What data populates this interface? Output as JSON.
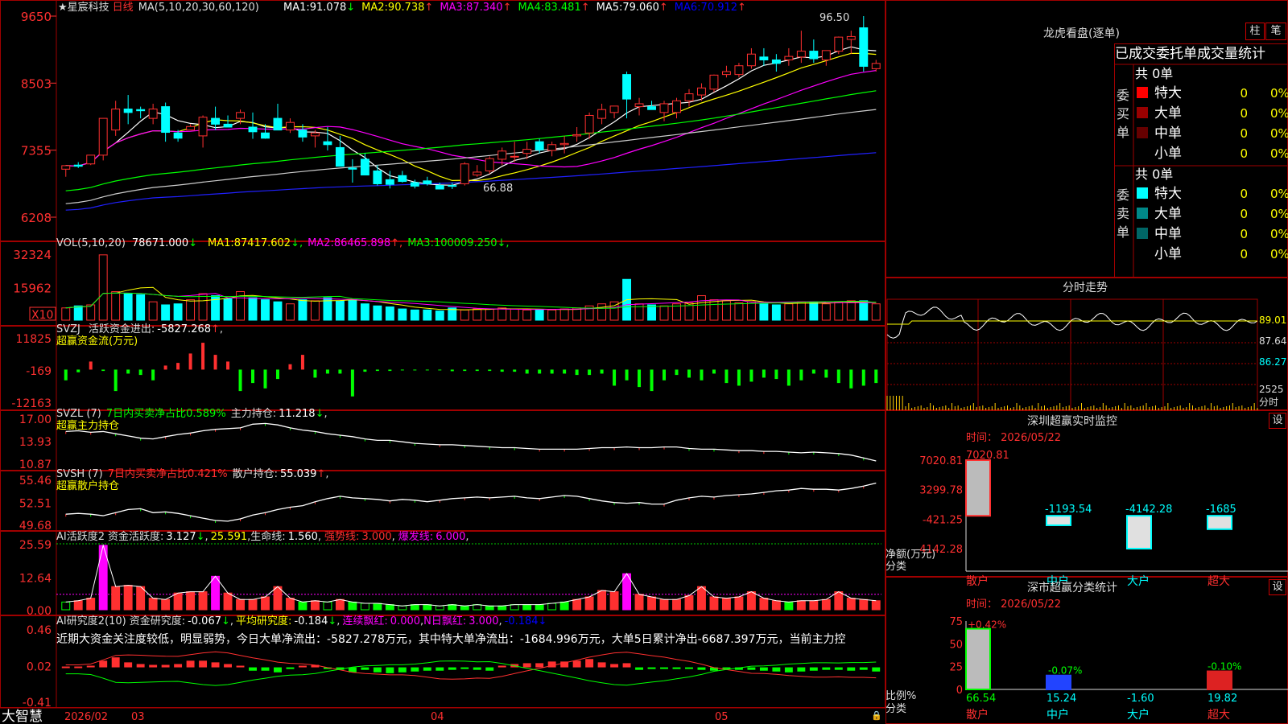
{
  "app": {
    "title": "大智慧"
  },
  "header": {
    "symbol_name": "星宸科技",
    "period": "日线",
    "ma_set": "MA(5,10,20,30,60,120)",
    "ma": [
      {
        "label": "MA1:",
        "value": "91.078",
        "arrow": "↓",
        "color": "#ffffff"
      },
      {
        "label": "MA2:",
        "value": "90.738",
        "arrow": "↑",
        "color": "#ffff00"
      },
      {
        "label": "MA3:",
        "value": "87.340",
        "arrow": "↑",
        "color": "#ff00ff"
      },
      {
        "label": "MA4:",
        "value": "83.481",
        "arrow": "↑",
        "color": "#00ff00"
      },
      {
        "label": "MA5:",
        "value": "79.060",
        "arrow": "↑",
        "color": "#ffffff"
      },
      {
        "label": "MA6:",
        "value": "70.912",
        "arrow": "↑",
        "color": "#0000ff"
      }
    ]
  },
  "kline_axis": [
    "9650",
    "8503",
    "7355",
    "6208"
  ],
  "kline_marks": {
    "high": "96.50",
    "low": "66.88"
  },
  "vol": {
    "title": "VOL(5,10,20)",
    "value": "78671.000",
    "value_arrow": "↓",
    "ma": [
      {
        "label": "MA1:",
        "value": "87417.602",
        "arrow": "↓",
        "color": "#ffff00"
      },
      {
        "label": "MA2:",
        "value": "86465.898",
        "arrow": "↑",
        "color": "#ff00ff"
      },
      {
        "label": "MA3:",
        "value": "100009.250",
        "arrow": "↓",
        "color": "#00ff00"
      }
    ],
    "axis": [
      "32324",
      "15962"
    ],
    "unit": "X10"
  },
  "svzj": {
    "title": "SVZJ",
    "label": "活跃资金进出:",
    "value": "-5827.268",
    "value_arrow": "↑",
    "sub": "超赢资金流(万元)",
    "axis": [
      "11825",
      "-169",
      "-12163"
    ]
  },
  "svzl": {
    "title": "SVZL (7)",
    "desc": "7日内买卖净占比0.589%",
    "label": "主力持仓:",
    "value": "11.218",
    "value_arrow": "↓",
    "sub": "超赢主力持仓",
    "axis": [
      "17.00",
      "13.93",
      "10.87"
    ]
  },
  "svsh": {
    "title": "SVSH (7)",
    "desc": "7日内买卖净占比0.421%",
    "label": "散户持仓:",
    "value": "55.039",
    "value_arrow": "↑",
    "sub": "超赢散户持仓",
    "axis": [
      "55.46",
      "52.51",
      "49.68"
    ]
  },
  "ai_active": {
    "title": "AI活跃度2",
    "label": "资金活跃度:",
    "value": "3.127",
    "value_arrow": "↓",
    "v2": "25.591",
    "life_label": "生命线:",
    "life": "1.560",
    "strong_label": "强势线:",
    "strong": "3.000",
    "burst_label": "爆发线:",
    "burst": "6.000",
    "axis": [
      "25.59",
      "12.64",
      "0.00"
    ]
  },
  "ai_research": {
    "title": "AI研究度2(10)",
    "label": "资金研究度:",
    "value": "-0.067",
    "value_arrow": "↓",
    "avg_label": "平均研究度:",
    "avg": "-0.184",
    "avg_arrow": "↓",
    "red_label": "连续飘红:",
    "red": "0.000",
    "nred_label": "N日飘红:",
    "nred": "3.000",
    "last": "-0.184",
    "last_arrow": "↓",
    "comment": "近期大资金关注度较低，明显弱势，今日大单净流出：-5827.278万元，其中特大单净流出：-1684.996万元，大单5日累计净出-6687.397万元，当前主力控",
    "axis": [
      "0.46",
      "0.02",
      "-0.41"
    ]
  },
  "date_axis": [
    "2026/02",
    "03",
    "04",
    "05"
  ],
  "right": {
    "dragon_title": "龙虎看盘(逐单)",
    "tab_bar": "柱",
    "tab_pen": "笔",
    "stats_title": "已成交委托单成交量统计",
    "buy": {
      "side": "委买单",
      "total": "共 0单",
      "rows": [
        {
          "name": "特大",
          "color": "#ff0000",
          "qty": "0",
          "pct": "0%"
        },
        {
          "name": "大单",
          "color": "#990000",
          "qty": "0",
          "pct": "0%"
        },
        {
          "name": "中单",
          "color": "#660000",
          "qty": "0",
          "pct": "0%"
        },
        {
          "name": "小单",
          "color": "#000000",
          "qty": "0",
          "pct": "0%"
        }
      ]
    },
    "sell": {
      "side": "委卖单",
      "total": "共 0单",
      "rows": [
        {
          "name": "特大",
          "color": "#00ffff",
          "qty": "0",
          "pct": "0%"
        },
        {
          "name": "大单",
          "color": "#008888",
          "qty": "0",
          "pct": "0%"
        },
        {
          "name": "中单",
          "color": "#006666",
          "qty": "0",
          "pct": "0%"
        },
        {
          "name": "小单",
          "color": "#000000",
          "qty": "0",
          "pct": "0%"
        }
      ]
    },
    "intraday_title": "分时走势",
    "intraday_axis": [
      "89.01",
      "87.64",
      "86.27",
      "2525"
    ],
    "intraday_unit": "分时",
    "monitor_title": "深圳超赢实时监控",
    "monitor_time": "时间：  2026/05/22",
    "monitor_axis": [
      "7020.81",
      "3299.78",
      "-421.25",
      "-4142.28"
    ],
    "monitor_ylabel": "净额(万元)",
    "monitor_xlabel": "分类",
    "monitor_values": [
      "7020.81",
      "-1193.54",
      "-4142.28",
      "-1685"
    ],
    "categories": [
      "散户",
      "中户",
      "大户",
      "超大"
    ],
    "set_label": "设",
    "class_title": "深市超赢分类统计",
    "class_time": "时间：  2026/05/22",
    "class_axis": [
      "75",
      "50",
      "25",
      "0"
    ],
    "class_ylabel": "比例%",
    "class_xlabel": "分类",
    "class_top": [
      "+0.42%",
      "-0.07%",
      "-0.10%"
    ],
    "class_bottom": [
      "66.54",
      "15.24",
      "-1.60",
      "19.82"
    ]
  },
  "chart_data": [
    {
      "type": "candlestick",
      "title": "星宸科技 日线",
      "ylim": [
        62.08,
        96.5
      ],
      "ticks": [
        96.5,
        85.03,
        73.55,
        62.08
      ],
      "ohlc": [
        [
          70.3,
          71.0,
          69.0,
          70.9
        ],
        [
          71.0,
          71.5,
          70.5,
          70.8
        ],
        [
          71.2,
          72.7,
          71.0,
          72.7
        ],
        [
          72.7,
          79.0,
          71.8,
          79.0
        ],
        [
          77.0,
          82.0,
          76.0,
          80.6
        ],
        [
          80.6,
          83.0,
          78.0,
          80.0
        ],
        [
          80.5,
          81.0,
          79.0,
          80.3
        ],
        [
          79.0,
          81.5,
          78.0,
          80.6
        ],
        [
          81.0,
          81.7,
          75.0,
          76.6
        ],
        [
          76.5,
          77.0,
          75.0,
          75.6
        ],
        [
          77.0,
          78.0,
          77.0,
          77.6
        ],
        [
          76.0,
          79.5,
          74.0,
          79.2
        ],
        [
          79.0,
          81.0,
          77.0,
          78.0
        ],
        [
          78.0,
          79.5,
          77.5,
          77.5
        ],
        [
          79.0,
          80.5,
          78.0,
          80.0
        ],
        [
          77.5,
          80.0,
          75.5,
          76.7
        ],
        [
          76.5,
          78.0,
          75.5,
          75.6
        ],
        [
          79.0,
          81.5,
          78.0,
          77.0
        ],
        [
          77.0,
          79.0,
          76.5,
          78.3
        ],
        [
          77.0,
          78.0,
          75.0,
          75.8
        ],
        [
          76.0,
          77.0,
          74.0,
          76.5
        ],
        [
          75.0,
          77.5,
          73.5,
          74.5
        ],
        [
          74.0,
          76.0,
          72.0,
          70.8
        ],
        [
          70.5,
          72.0,
          68.0,
          70.3
        ],
        [
          72.0,
          73.0,
          70.0,
          69.3
        ],
        [
          70.0,
          71.0,
          67.5,
          67.8
        ],
        [
          68.5,
          70.0,
          67.0,
          67.7
        ],
        [
          69.2,
          70.0,
          68.0,
          68.2
        ],
        [
          68.0,
          68.5,
          67.0,
          67.4
        ],
        [
          68.3,
          69.0,
          67.5,
          67.8
        ],
        [
          67.5,
          68.0,
          66.9,
          66.9
        ],
        [
          67.5,
          68.0,
          66.9,
          67.4
        ],
        [
          67.8,
          71.5,
          67.5,
          71.2
        ],
        [
          69.3,
          71.0,
          69.0,
          69.8
        ],
        [
          70.0,
          72.5,
          69.5,
          72.1
        ],
        [
          72.0,
          74.0,
          71.0,
          73.4
        ],
        [
          72.5,
          75.0,
          71.5,
          72.5
        ],
        [
          73.0,
          75.0,
          72.0,
          73.7
        ],
        [
          75.0,
          75.5,
          73.0,
          73.6
        ],
        [
          73.5,
          75.0,
          72.5,
          74.5
        ],
        [
          74.5,
          76.0,
          73.0,
          74.7
        ],
        [
          76.0,
          77.5,
          75.0,
          76.2
        ],
        [
          76.5,
          80.0,
          75.5,
          79.5
        ],
        [
          79.0,
          81.5,
          78.0,
          80.5
        ],
        [
          80.0,
          81.0,
          79.0,
          81.1
        ],
        [
          86.5,
          87.0,
          79.0,
          82.3
        ],
        [
          81.0,
          82.5,
          79.5,
          81.5
        ],
        [
          81.0,
          82.0,
          80.5,
          80.5
        ],
        [
          80.0,
          82.0,
          78.5,
          81.5
        ],
        [
          80.0,
          82.5,
          79.0,
          82.0
        ],
        [
          82.0,
          84.0,
          81.0,
          83.2
        ],
        [
          83.0,
          85.0,
          82.0,
          84.2
        ],
        [
          84.0,
          86.5,
          83.5,
          86.4
        ],
        [
          86.5,
          88.0,
          86.0,
          87.0
        ],
        [
          86.5,
          88.5,
          86.0,
          88.0
        ],
        [
          88.0,
          91.0,
          87.5,
          90.0
        ],
        [
          89.5,
          91.0,
          88.0,
          89.0
        ],
        [
          89.0,
          90.0,
          87.0,
          88.4
        ],
        [
          89.0,
          91.0,
          88.0,
          89.6
        ],
        [
          89.5,
          94.0,
          88.5,
          90.5
        ],
        [
          90.5,
          92.5,
          88.5,
          89.2
        ],
        [
          89.0,
          90.5,
          88.0,
          90.6
        ],
        [
          90.5,
          93.0,
          90.0,
          92.9
        ],
        [
          92.5,
          94.0,
          90.0,
          93.0
        ],
        [
          94.5,
          96.5,
          87.0,
          87.9
        ],
        [
          87.5,
          89.0,
          87.0,
          88.4
        ]
      ],
      "ma_series": [
        "MA1",
        "MA2",
        "MA3",
        "MA4",
        "MA5",
        "MA6"
      ]
    },
    {
      "type": "bar",
      "title": "VOL(5,10,20)",
      "ylim": [
        0,
        32324
      ],
      "ticks": [
        32324,
        15962
      ],
      "values": [
        6000,
        7000,
        7500,
        32000,
        14000,
        13000,
        12500,
        9000,
        7500,
        8000,
        10000,
        13000,
        12000,
        10500,
        14000,
        11000,
        10000,
        9000,
        8000,
        10000,
        9500,
        11000,
        9500,
        10000,
        8000,
        7000,
        6500,
        5500,
        5000,
        5000,
        4500,
        6000,
        5000,
        5500,
        5500,
        6000,
        5500,
        5000,
        5000,
        5000,
        5500,
        6000,
        7000,
        8000,
        9000,
        20000,
        8000,
        7500,
        7000,
        8000,
        8500,
        12000,
        10000,
        9500,
        8500,
        9000,
        8000,
        7500,
        8000,
        9000,
        9000,
        8000,
        9000,
        9500,
        9500,
        8000
      ]
    },
    {
      "type": "bar",
      "title": "SVZJ",
      "ylim": [
        -12163,
        11825
      ],
      "ticks": [
        11825,
        -169,
        -12163
      ],
      "values": [
        -4000,
        -1000,
        3000,
        -500,
        -8000,
        -1500,
        -2000,
        -4000,
        1500,
        2500,
        6000,
        10000,
        5500,
        3000,
        -8000,
        -5000,
        -7000,
        -3500,
        2000,
        5500,
        -3000,
        -1500,
        -1500,
        -10000,
        -800,
        -500,
        -500,
        -300,
        -300,
        -300,
        -300,
        -600,
        -500,
        -500,
        -500,
        -800,
        -800,
        -1500,
        -1500,
        -1500,
        -1500,
        -2000,
        -2000,
        -1500,
        -6000,
        -4000,
        -6500,
        -8000,
        -4000,
        -2000,
        -3000,
        -4000,
        -1500,
        -5000,
        -6000,
        -4500,
        -3000,
        -3500,
        -6000,
        -4000,
        -1500,
        -3000,
        -5000,
        -7000,
        -6000,
        -5000
      ]
    },
    {
      "type": "line",
      "title": "SVZL (7)",
      "ylim": [
        10.87,
        17.0
      ],
      "ticks": [
        17.0,
        13.93,
        10.87
      ],
      "values": [
        15.2,
        15.3,
        15.1,
        15.2,
        14.9,
        14.6,
        14.3,
        14.2,
        14.5,
        14.8,
        15.0,
        15.3,
        15.5,
        15.6,
        15.7,
        16.2,
        16.3,
        16.1,
        15.7,
        15.4,
        15.2,
        14.9,
        14.7,
        14.5,
        14.2,
        14.0,
        14.0,
        13.8,
        13.6,
        13.5,
        13.4,
        13.4,
        13.3,
        13.2,
        13.1,
        13.0,
        13.0,
        12.9,
        12.8,
        12.8,
        12.8,
        12.8,
        12.9,
        13.0,
        13.0,
        13.1,
        13.0,
        13.0,
        13.1,
        13.1,
        12.9,
        12.8,
        12.8,
        12.7,
        12.6,
        12.6,
        12.5,
        12.5,
        12.4,
        12.3,
        12.4,
        12.3,
        12.2,
        12.0,
        11.6,
        11.2
      ]
    },
    {
      "type": "line",
      "title": "SVSH (7)",
      "ylim": [
        49.68,
        55.46
      ],
      "ticks": [
        55.46,
        52.51,
        49.68
      ],
      "values": [
        51.0,
        51.1,
        51.0,
        50.8,
        51.2,
        51.6,
        51.7,
        51.2,
        51.3,
        51.1,
        50.8,
        50.5,
        50.2,
        50.1,
        50.4,
        50.9,
        51.2,
        51.6,
        51.9,
        52.1,
        52.6,
        53.0,
        53.3,
        53.1,
        53.0,
        52.9,
        52.7,
        52.9,
        52.8,
        52.6,
        52.8,
        53.0,
        53.1,
        53.2,
        53.1,
        53.2,
        53.3,
        53.1,
        53.0,
        53.2,
        53.4,
        53.3,
        53.0,
        52.7,
        52.5,
        52.4,
        52.5,
        52.3,
        52.3,
        52.8,
        53.1,
        53.3,
        53.2,
        53.4,
        53.5,
        53.6,
        53.8,
        54.0,
        54.1,
        54.3,
        54.2,
        54.2,
        54.1,
        54.3,
        54.6,
        55.0
      ]
    },
    {
      "type": "bar",
      "title": "AI活跃度2",
      "ylim": [
        0,
        25.59
      ],
      "ticks": [
        25.59,
        12.64,
        0.0
      ],
      "values": [
        3.0,
        3.5,
        4.5,
        25.0,
        9.0,
        9.5,
        9.0,
        4.5,
        4.0,
        6.5,
        7.0,
        7.0,
        13.0,
        6.5,
        4.0,
        4.0,
        5.0,
        9.0,
        4.5,
        3.0,
        3.5,
        3.0,
        4.0,
        3.0,
        2.5,
        2.5,
        2.0,
        1.5,
        2.0,
        2.0,
        1.5,
        2.0,
        1.5,
        2.0,
        1.5,
        1.5,
        2.0,
        2.0,
        2.0,
        2.5,
        3.0,
        4.0,
        5.0,
        7.5,
        7.0,
        14.0,
        6.0,
        5.0,
        4.0,
        4.0,
        5.5,
        9.0,
        5.0,
        4.5,
        5.0,
        7.0,
        4.5,
        3.5,
        3.0,
        3.5,
        3.5,
        4.0,
        7.0,
        4.5,
        4.0,
        3.5
      ]
    },
    {
      "type": "bar",
      "title": "AI研究度2(10)",
      "ylim": [
        -0.41,
        0.46
      ],
      "ticks": [
        0.46,
        0.02,
        -0.41
      ],
      "values": [
        0.01,
        0.01,
        0.02,
        0.08,
        0.12,
        0.06,
        0.04,
        0.03,
        0.03,
        0.04,
        0.08,
        0.08,
        0.06,
        0.04,
        0.02,
        -0.04,
        -0.04,
        -0.06,
        -0.02,
        0.02,
        0.03,
        -0.02,
        -0.03,
        -0.06,
        -0.03,
        -0.06,
        -0.07,
        -0.06,
        -0.05,
        -0.04,
        -0.04,
        -0.03,
        -0.02,
        -0.03,
        -0.04,
        0.02,
        0.04,
        0.05,
        0.05,
        0.07,
        0.07,
        0.08,
        0.1,
        0.06,
        0.04,
        0.05,
        -0.03,
        -0.02,
        -0.01,
        -0.02,
        -0.01,
        -0.03,
        -0.04,
        -0.02,
        -0.03,
        -0.03,
        -0.04,
        -0.05,
        -0.06,
        -0.05,
        -0.04,
        -0.03,
        -0.03,
        -0.04,
        -0.03,
        -0.05
      ]
    },
    {
      "type": "bar",
      "title": "深圳超赢实时监控",
      "categories": [
        "散户",
        "中户",
        "大户",
        "超大"
      ],
      "values": [
        7020.81,
        -1193.54,
        -4142.28,
        -1685
      ],
      "ylim": [
        -4142.28,
        7020.81
      ],
      "ylabel": "净额(万元)",
      "xlabel": "分类"
    },
    {
      "type": "bar",
      "title": "深市超赢分类统计",
      "categories": [
        "散户",
        "中户",
        "大户",
        "超大"
      ],
      "values": [
        66.54,
        15.24,
        -1.6,
        19.82
      ],
      "ylim": [
        0,
        75
      ],
      "ylabel": "比例%",
      "xlabel": "分类"
    }
  ]
}
